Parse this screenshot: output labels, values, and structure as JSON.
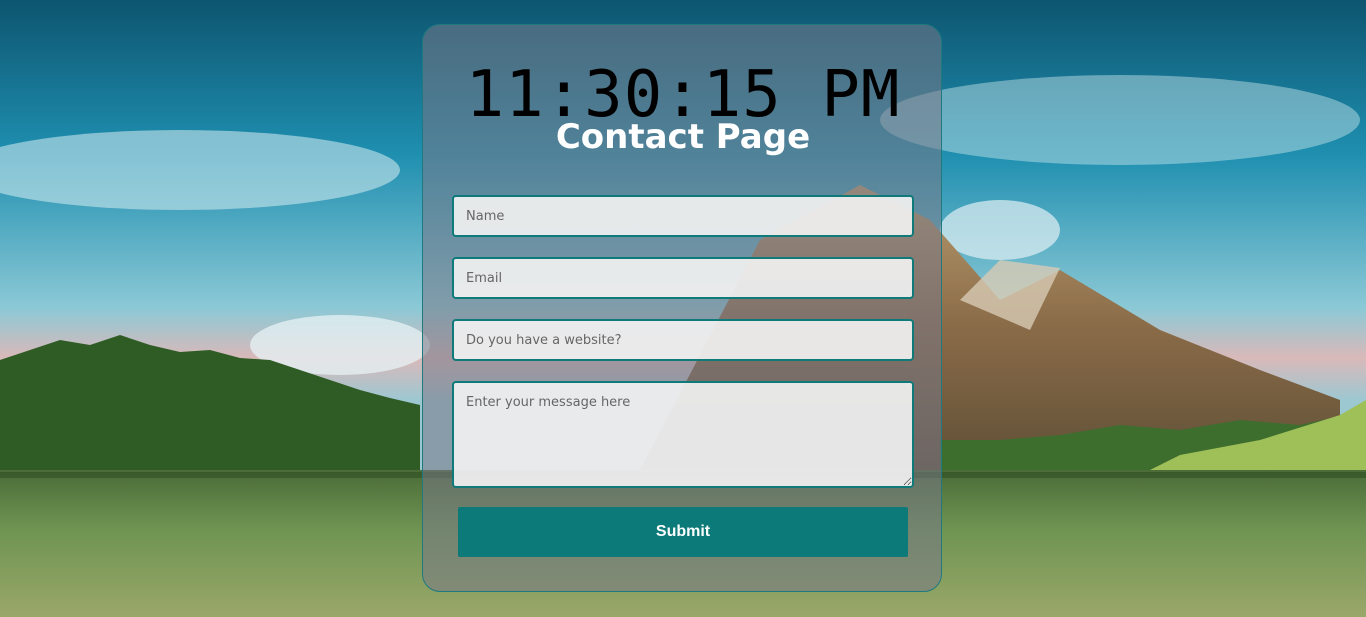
{
  "clock": {
    "time": "11:30:15 PM"
  },
  "page": {
    "title": "Contact Page"
  },
  "form": {
    "name_placeholder": "Name",
    "email_placeholder": "Email",
    "website_placeholder": "Do you have a website?",
    "message_placeholder": "Enter your message here",
    "name_value": "",
    "email_value": "",
    "website_value": "",
    "message_value": "",
    "submit_label": "Submit"
  },
  "colors": {
    "accent": "#0b7a78",
    "field_border": "#0e7a7a",
    "title_text": "#ffffff",
    "clock_text": "#000000"
  }
}
